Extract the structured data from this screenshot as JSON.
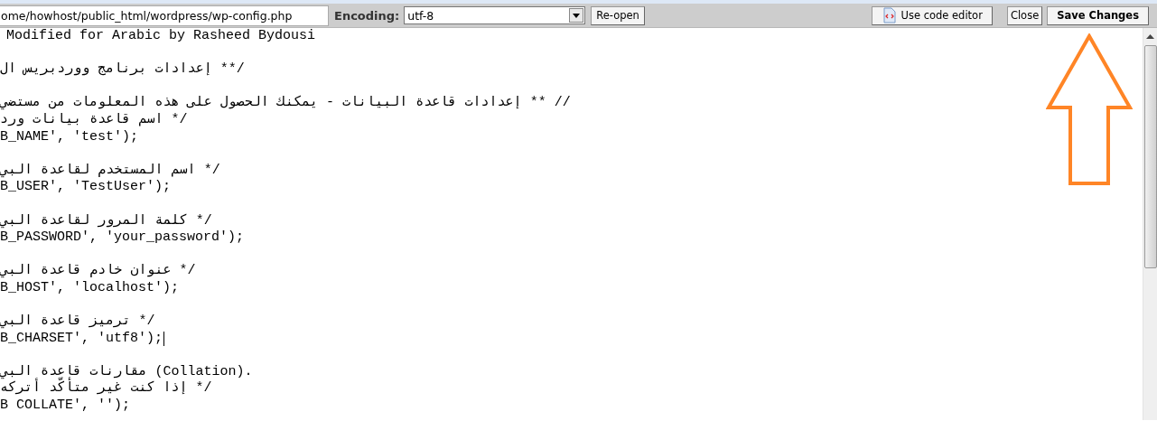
{
  "toolbar": {
    "path": "ome/howhost/public_html/wordpress/wp-config.php",
    "encoding_label": "Encoding:",
    "encoding_value": "utf-8",
    "reopen_button": "Re-open",
    "code_editor_button": "Use code editor",
    "close_button": "Close",
    "save_button": "Save Changes"
  },
  "editor": {
    "blocks": [
      [
        {
          "text": "Modified for Arabic by Rasheed Bydousi",
          "caret": false
        }
      ],
      [
        {
          "text": "إعدادات برنامج ووردبريس ال **/",
          "caret": false
        }
      ],
      [
        {
          "text": "إعدادات قاعدة البيانات - يمكنك الحصول على هذه المعلومات من مستضي ** //",
          "caret": false
        },
        {
          "text": "اسم قاعدة بيانات ورد */",
          "caret": false
        },
        {
          "text": "B_NAME', 'test');",
          "caret": false
        }
      ],
      [
        {
          "text": "اسم المستخدم لقاعدة البي */",
          "caret": false
        },
        {
          "text": "B_USER', 'TestUser');",
          "caret": false
        }
      ],
      [
        {
          "text": "كلمة المرور لقاعدة البي */",
          "caret": false
        },
        {
          "text": "B_PASSWORD', 'your_password');",
          "caret": false
        }
      ],
      [
        {
          "text": "عنوان خادم قاعدة البي */",
          "caret": false
        },
        {
          "text": "B_HOST', 'localhost');",
          "caret": false
        }
      ],
      [
        {
          "text": "ترميز قاعدة البي */",
          "caret": false
        },
        {
          "text": "B_CHARSET', 'utf8');",
          "caret": true
        }
      ],
      [
        {
          "text": "مقارنات قاعدة البي (Collation).",
          "caret": false
        },
        {
          "text": "إذا كنت غير متأكّد أتركه */",
          "caret": false
        },
        {
          "text": "B COLLATE', '');",
          "caret": false
        }
      ]
    ]
  }
}
